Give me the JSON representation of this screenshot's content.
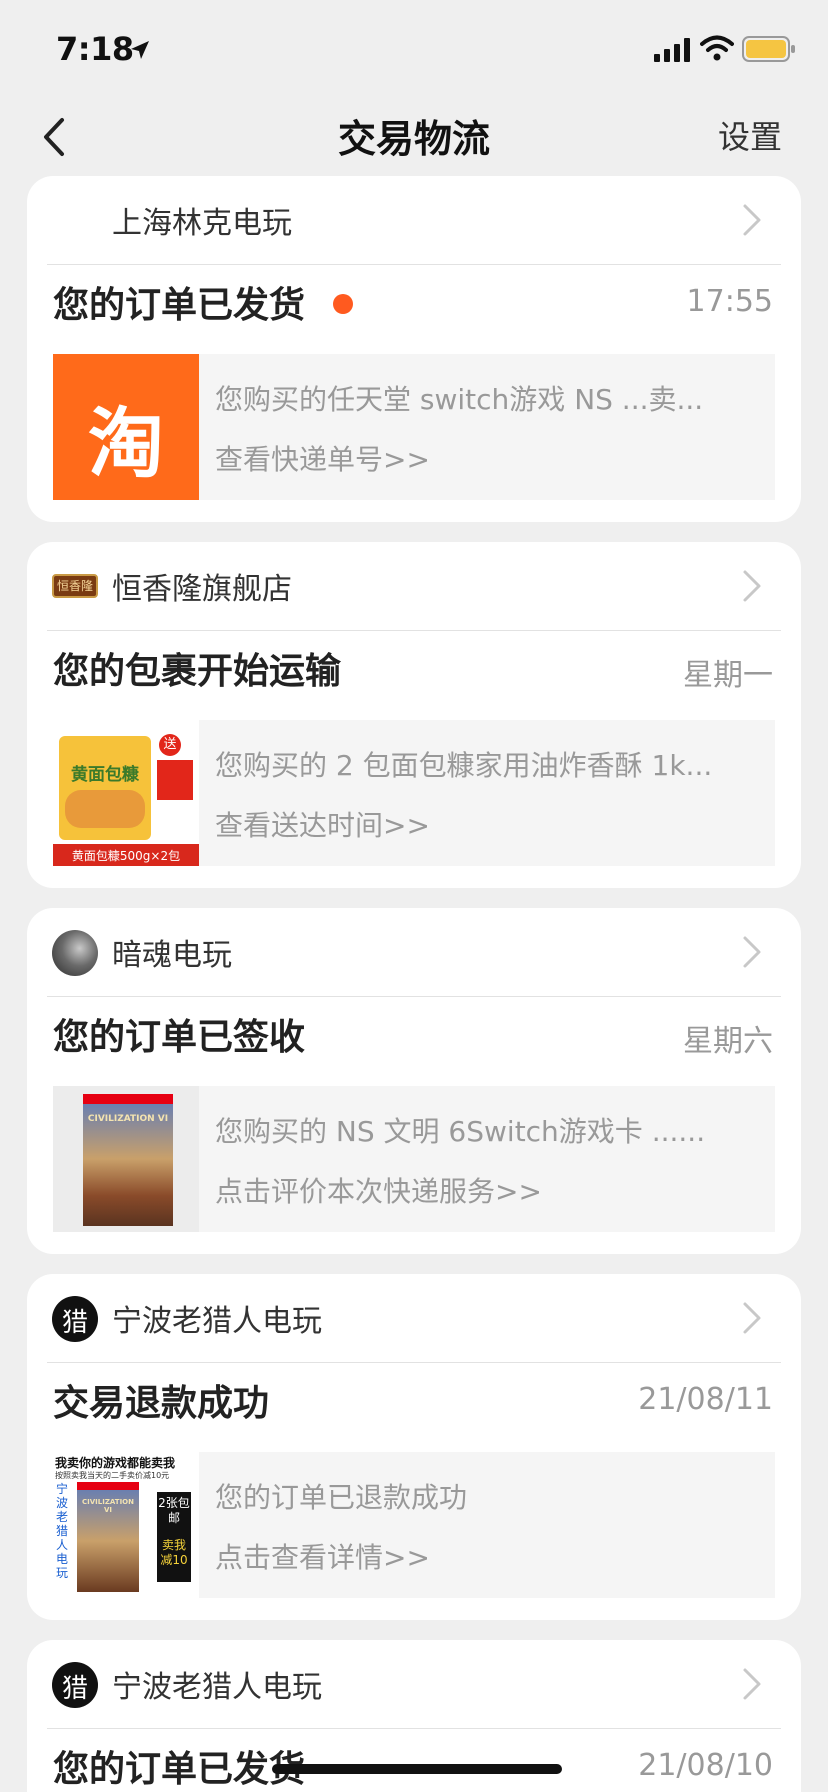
{
  "status_bar": {
    "time": "7:18",
    "location_icon": "location-arrow-icon",
    "signal_icon": "cellular-signal-icon",
    "wifi_icon": "wifi-icon",
    "battery_icon": "battery-icon",
    "battery_color": "#f5c542"
  },
  "nav": {
    "title": "交易物流",
    "settings_label": "设置",
    "back_icon": "back-chevron-icon"
  },
  "colors": {
    "accent": "#ff5a1f",
    "taobao_orange": "#ff6a1a",
    "card_bg": "#ffffff",
    "page_bg": "#efefef"
  },
  "cards": [
    {
      "shop": "上海林克电玩",
      "avatar": "none",
      "title": "您的订单已发货",
      "unread": true,
      "time": "17:55",
      "thumb": {
        "icon": "taobao-logo-icon",
        "text": "淘"
      },
      "desc": "您购买的任天堂 switch游戏 NS ...卖...",
      "link": "查看快递单号>>"
    },
    {
      "shop": "恒香隆旗舰店",
      "avatar": "brand-logo-icon",
      "avatar_text": "恒香隆",
      "title": "您的包裹开始运输",
      "unread": false,
      "time": "星期一",
      "thumb": {
        "icon": "bread-crumbs-product-image",
        "text": "黄面包糠",
        "caption": "黄面包糠500g×2包",
        "badge": "送"
      },
      "desc": "您购买的 2 包面包糠家用油炸香酥 1k...",
      "link": "查看送达时间>>"
    },
    {
      "shop": "暗魂电玩",
      "avatar": "user-photo-avatar",
      "title": "您的订单已签收",
      "unread": false,
      "time": "星期六",
      "thumb": {
        "icon": "game-box-product-image",
        "text": "CIVILIZATION VI"
      },
      "desc": "您购买的 NS 文明 6Switch游戏卡 ......",
      "link": "点击评价本次快递服务>>"
    },
    {
      "shop": "宁波老猎人电玩",
      "avatar": "hunter-logo-icon",
      "avatar_text": "猎",
      "title": "交易退款成功",
      "unread": false,
      "time": "21/08/11",
      "thumb": {
        "icon": "game-ad-product-image",
        "headline": "我卖你的游戏都能卖我",
        "subline": "按照卖我当天的二手卖价减10元",
        "side_text": "宁波老猎人电玩",
        "badge_top": "2张包邮",
        "badge_bottom": "卖我减10",
        "game_text": "CIVILIZATION VI"
      },
      "desc": "您的订单已退款成功",
      "link": "点击查看详情>>"
    },
    {
      "shop": "宁波老猎人电玩",
      "avatar": "hunter-logo-icon",
      "avatar_text": "猎",
      "title": "您的订单已发货",
      "unread": false,
      "time": "21/08/10"
    }
  ]
}
